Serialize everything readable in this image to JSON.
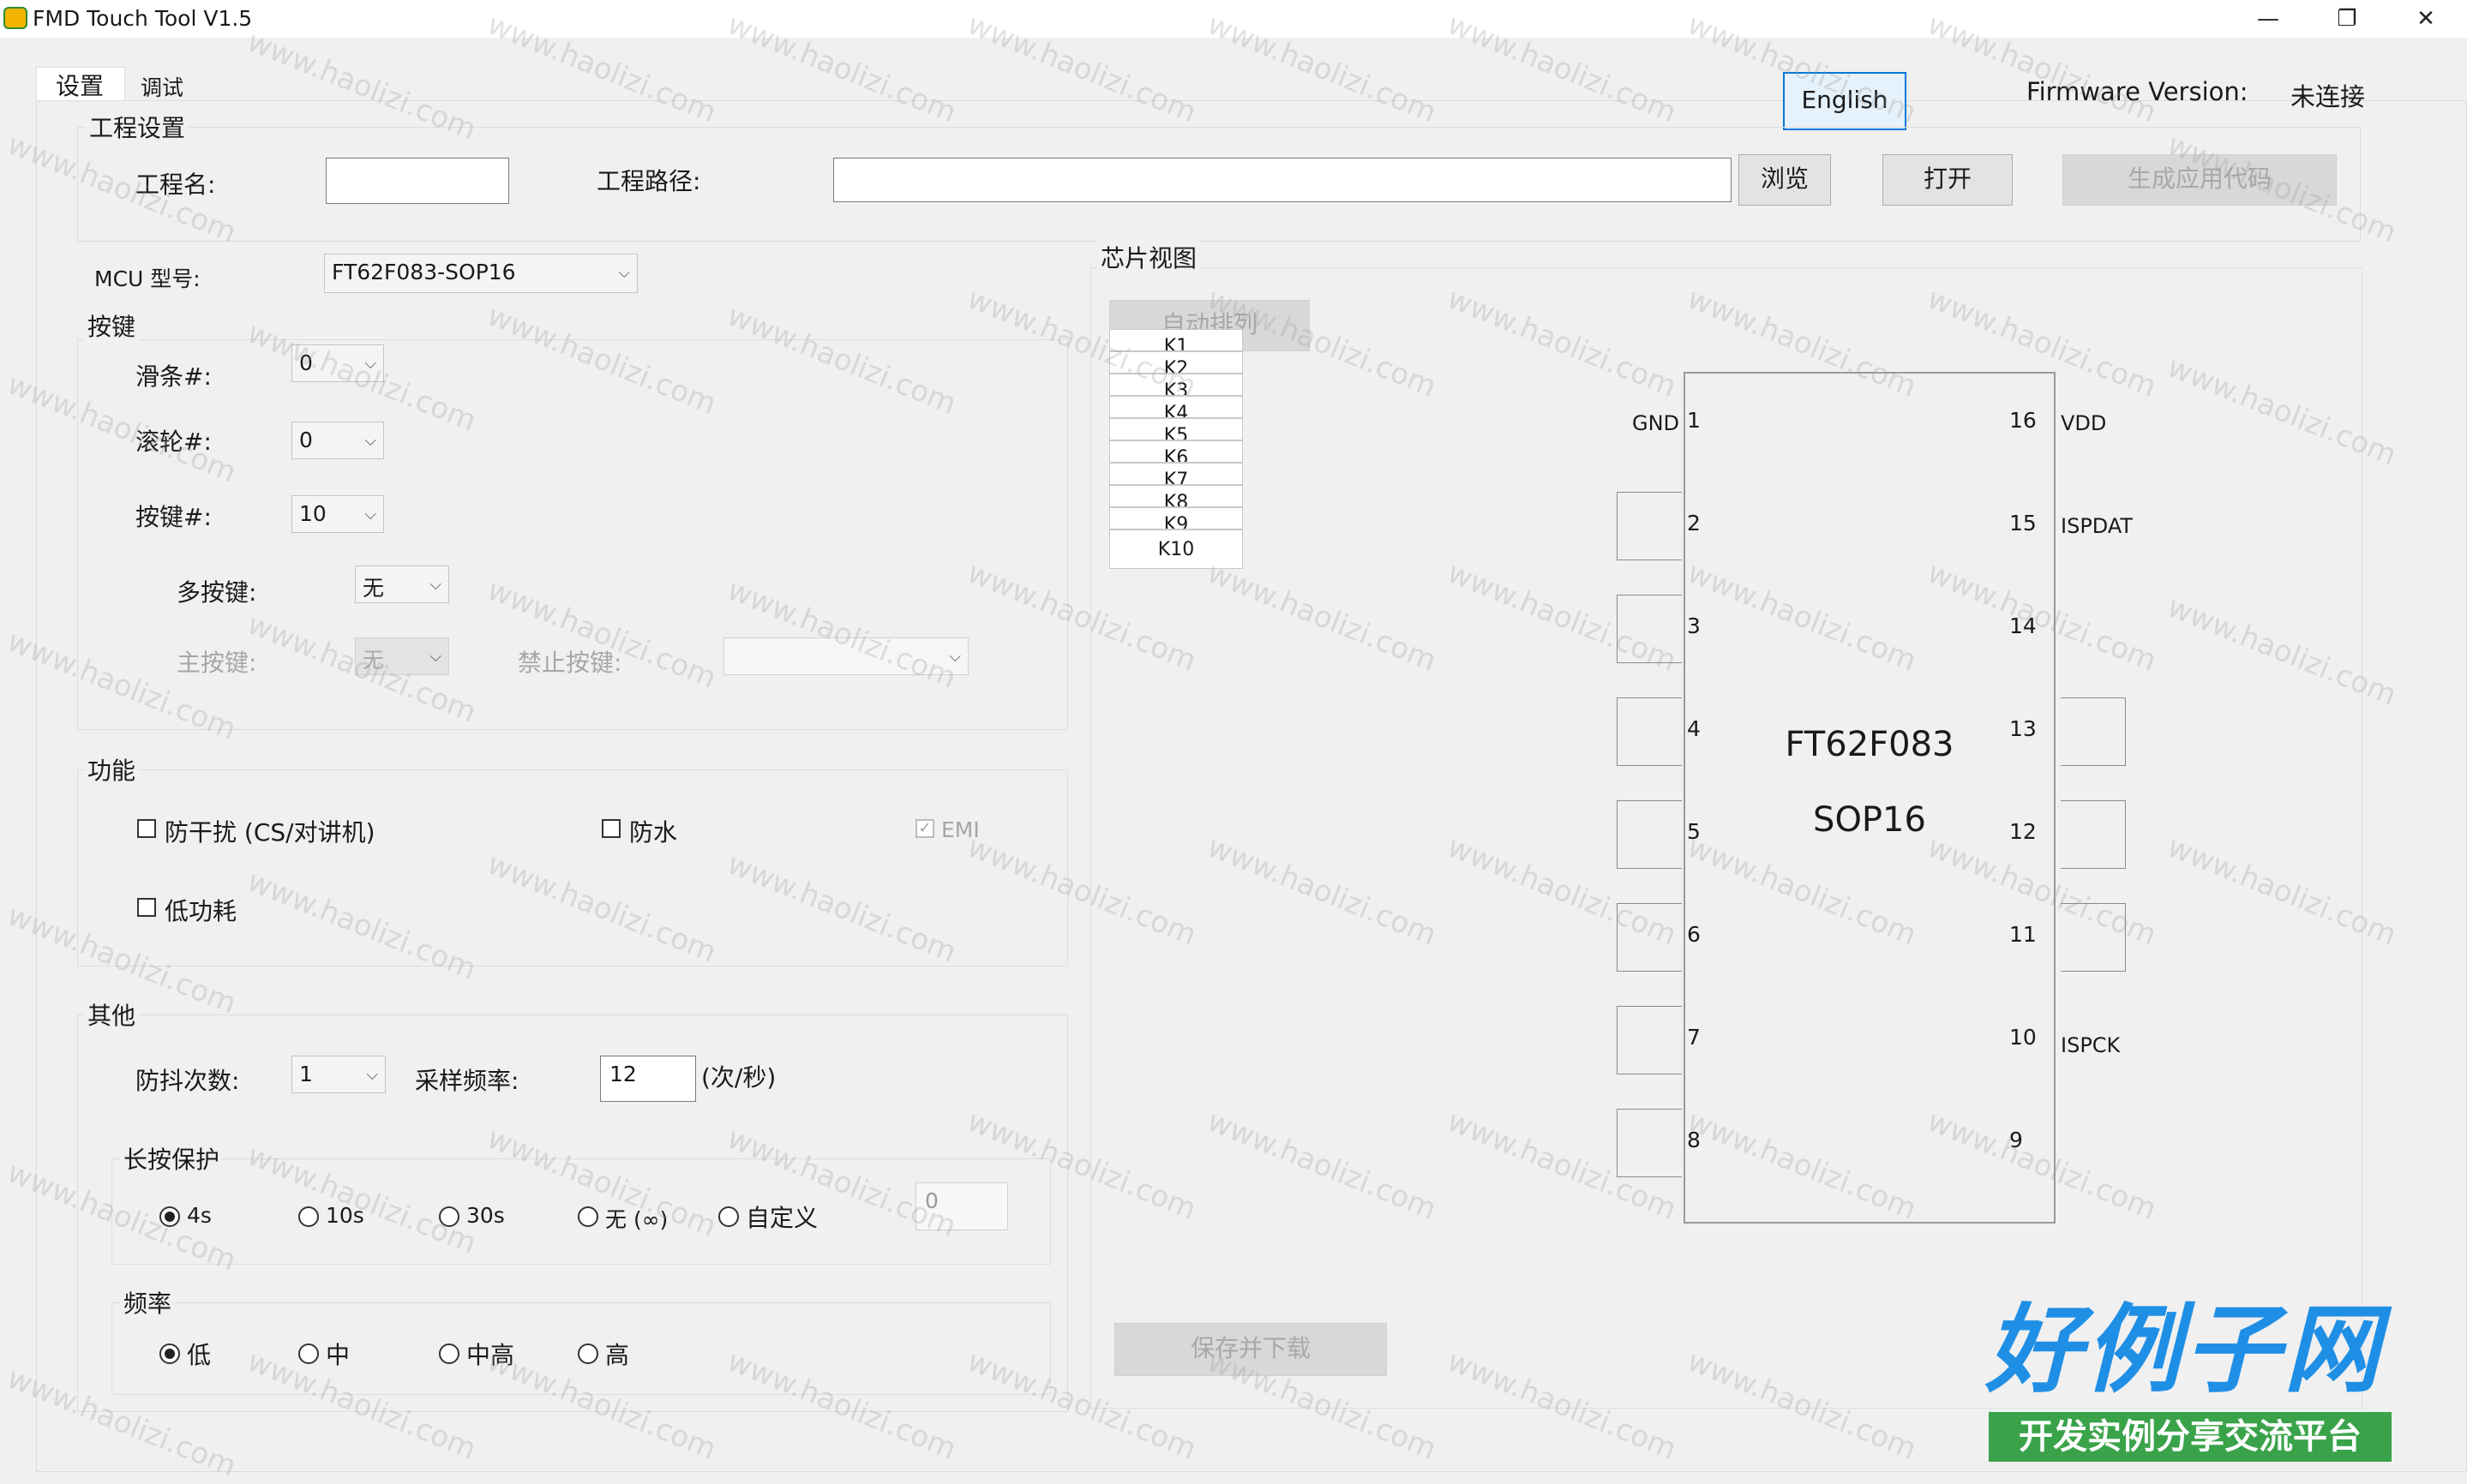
{
  "window": {
    "title": "FMD Touch Tool V1.5",
    "controls": [
      "—",
      "❐",
      "✕"
    ]
  },
  "tabs": [
    {
      "label": "设置",
      "active": true
    },
    {
      "label": "调试",
      "active": false
    }
  ],
  "header": {
    "language_button": "English",
    "firmware_label": "Firmware Version:",
    "firmware_value": "未连接"
  },
  "project": {
    "group_title": "工程设置",
    "name_label": "工程名:",
    "name_value": "",
    "path_label": "工程路径:",
    "path_value": "",
    "browse_button": "浏览",
    "open_button": "打开",
    "generate_button": "生成应用代码"
  },
  "mcu": {
    "label": "MCU 型号:",
    "value": "FT62F083-SOP16"
  },
  "keys": {
    "group_title": "按键",
    "slider_label": "滑条#:",
    "slider_value": "0",
    "wheel_label": "滚轮#:",
    "wheel_value": "0",
    "button_label": "按键#:",
    "button_value": "10",
    "multi_label": "多按键:",
    "multi_value": "无",
    "main_label": "主按键:",
    "main_value": "无",
    "forbid_label": "禁止按键:",
    "forbid_value": ""
  },
  "features": {
    "group_title": "功能",
    "anti_interference": {
      "label": "防干扰 (CS/对讲机)",
      "checked": false
    },
    "waterproof": {
      "label": "防水",
      "checked": false
    },
    "emi": {
      "label": "EMI",
      "checked": true,
      "disabled": true
    },
    "low_power": {
      "label": "低功耗",
      "checked": false
    }
  },
  "other": {
    "group_title": "其他",
    "debounce_label": "防抖次数:",
    "debounce_value": "1",
    "sample_label": "采样频率:",
    "sample_value": "12",
    "sample_unit": "(次/秒)",
    "long_press": {
      "title": "长按保护",
      "options": [
        "4s",
        "10s",
        "30s",
        "无 (∞)",
        "自定义"
      ],
      "selected": "4s",
      "custom_value": "0"
    },
    "frequency": {
      "title": "频率",
      "options": [
        "低",
        "中",
        "中高",
        "高"
      ],
      "selected": "低"
    }
  },
  "chip_view": {
    "group_title": "芯片视图",
    "auto_arrange_button": "自动排列",
    "key_list": [
      "K1",
      "K2",
      "K3",
      "K4",
      "K5",
      "K6",
      "K7",
      "K8",
      "K9",
      "K10"
    ],
    "chip_name": "FT62F083",
    "chip_package": "SOP16",
    "left_pins": [
      {
        "num": "1",
        "label": "GND"
      },
      {
        "num": "2",
        "label": ""
      },
      {
        "num": "3",
        "label": ""
      },
      {
        "num": "4",
        "label": ""
      },
      {
        "num": "5",
        "label": ""
      },
      {
        "num": "6",
        "label": ""
      },
      {
        "num": "7",
        "label": ""
      },
      {
        "num": "8",
        "label": ""
      }
    ],
    "right_pins": [
      {
        "num": "16",
        "label": "VDD"
      },
      {
        "num": "15",
        "label": "ISPDAT"
      },
      {
        "num": "14",
        "label": ""
      },
      {
        "num": "13",
        "label": ""
      },
      {
        "num": "12",
        "label": ""
      },
      {
        "num": "11",
        "label": ""
      },
      {
        "num": "10",
        "label": "ISPCK"
      },
      {
        "num": "9",
        "label": ""
      }
    ],
    "save_download_button": "保存并下载"
  },
  "watermark": {
    "text": "www.haolizi.com",
    "logo_main": "好例子网",
    "logo_sub": "开发实例分享交流平台"
  }
}
